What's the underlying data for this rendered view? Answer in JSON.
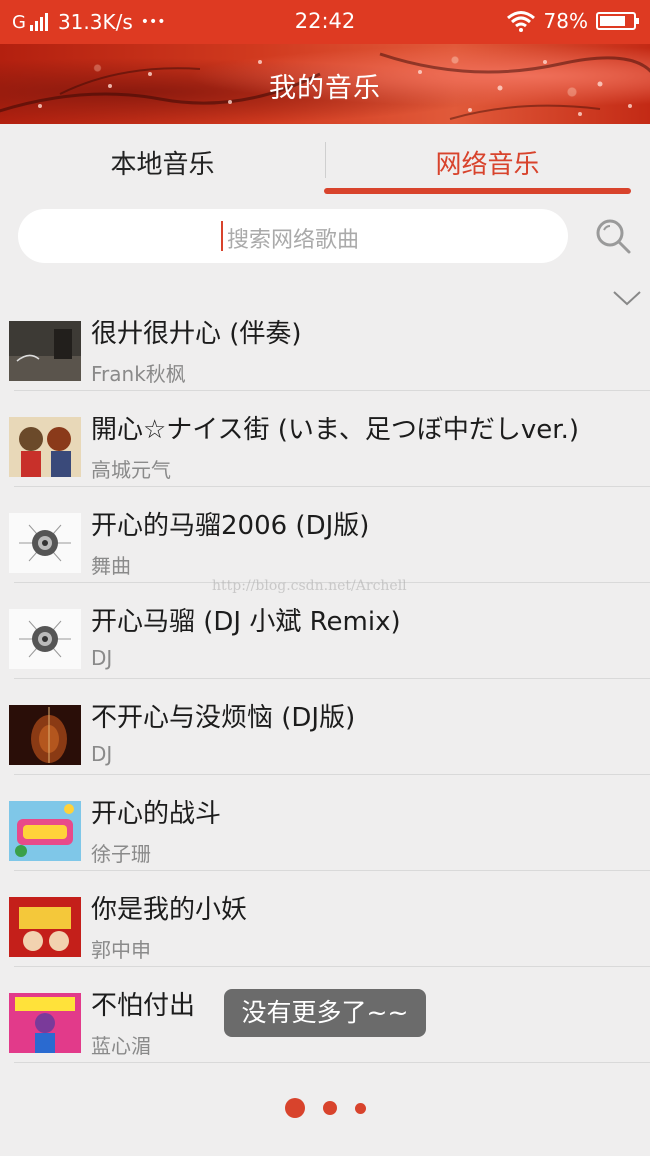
{
  "status_bar": {
    "network": "G",
    "speed": "31.3K/s",
    "more": "•••",
    "time": "22:42",
    "battery": "78%",
    "battery_level": 0.78
  },
  "header": {
    "title": "我的音乐"
  },
  "tabs": [
    {
      "label": "本地音乐",
      "active": false
    },
    {
      "label": "网络音乐",
      "active": true
    }
  ],
  "search": {
    "placeholder": "搜索网络歌曲"
  },
  "songs": [
    {
      "title": "很廾很廾心 (伴奏)",
      "artist": "Frank秋枫"
    },
    {
      "title": "開心☆ナイス街 (いま、足つぼ中だしver.)",
      "artist": "高城元气"
    },
    {
      "title": "开心的马骝2006 (DJ版)",
      "artist": "舞曲"
    },
    {
      "title": "开心马骝 (DJ 小斌 Remix)",
      "artist": "DJ"
    },
    {
      "title": "不开心与没烦恼 (DJ版)",
      "artist": "DJ"
    },
    {
      "title": "开心的战斗",
      "artist": "徐子珊"
    },
    {
      "title": "你是我的小妖",
      "artist": "郭中申"
    },
    {
      "title": "不怕付出",
      "artist": "蓝心湄"
    }
  ],
  "toast": "没有更多了~~",
  "watermark": "http://blog.csdn.net/Archell",
  "pager": {
    "pages": 3,
    "current": 1
  },
  "colors": {
    "accent": "#d8432c",
    "status_bar": "#de3a22"
  }
}
